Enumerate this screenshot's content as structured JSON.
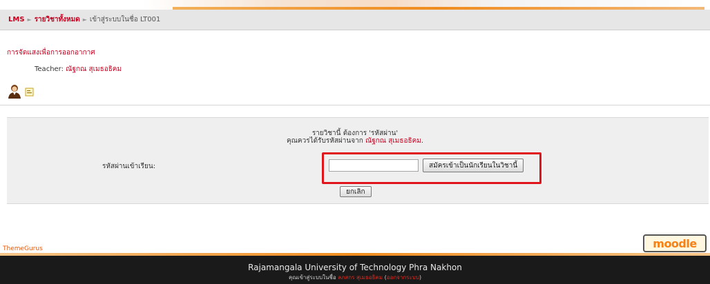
{
  "breadcrumb": {
    "root": "LMS",
    "all_courses": "รายวิชาทั้งหมด",
    "current": "เข้าสู่ระบบในชื่อ LT001",
    "separator": "►"
  },
  "course": {
    "name": "การจัดแสงเพื่อการออกอากาศ",
    "teacher_label": "Teacher: ",
    "teacher_name": "ณัฐกณ สุเมธอธิคม"
  },
  "enrol": {
    "message_line1": "รายวิชานี้ ต้องการ 'รหัสผ่าน'",
    "message_line2_prefix": "คุณควรได้รับรหัสผ่านจาก ",
    "message_teacher": "ณัฐกณ สุเมธอธิคม",
    "message_line2_suffix": ".",
    "password_label": "รหัสผ่านเข้าเรียน:",
    "password_value": "",
    "enrol_button": "สมัครเข้าเป็นนักเรียนในวิชานี้",
    "cancel_button": "ยกเลิก",
    "highlight_color": "#e0151c"
  },
  "footer": {
    "theme_credit": "ThemeGurus",
    "logo_text": "moodle",
    "university": "Rajamangala University of Technology Phra Nakhon",
    "login_prefix": "คุณเข้าสู่ระบบในชื่อ ",
    "login_user": "ลภสกร สุเมธอธิคม",
    "login_open": " (",
    "logout": "ออกจากระบบ",
    "login_close": ")"
  },
  "icons": {
    "teacher": "teacher-avatar-icon",
    "info": "info-key-icon"
  },
  "colors": {
    "link": "#c4001f",
    "accent": "#f08c1e",
    "footer_bg": "#1a1a1a"
  }
}
